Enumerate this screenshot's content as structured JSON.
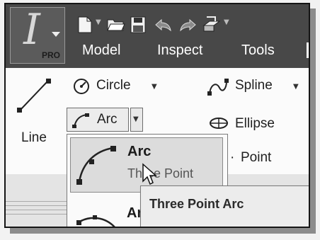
{
  "app": {
    "badge": "PRO"
  },
  "menu": {
    "tabs": [
      "Model",
      "Inspect",
      "Tools"
    ]
  },
  "ribbon": {
    "line_label": "Line",
    "circle_label": "Circle",
    "arc_label": "Arc",
    "spline_label": "Spline",
    "ellipse_label": "Ellipse",
    "point_label": "Point"
  },
  "dropdown": {
    "items": [
      {
        "title": "Arc",
        "subtitle": "Three Point"
      },
      {
        "title": "Ar"
      }
    ]
  },
  "tooltip": {
    "text": "Three Point Arc"
  },
  "colors": {
    "menu_bar": "#484848",
    "ribbon_bg": "#fbfbfb",
    "highlight": "#dcdcdc",
    "tooltip_bg": "#ececec"
  }
}
